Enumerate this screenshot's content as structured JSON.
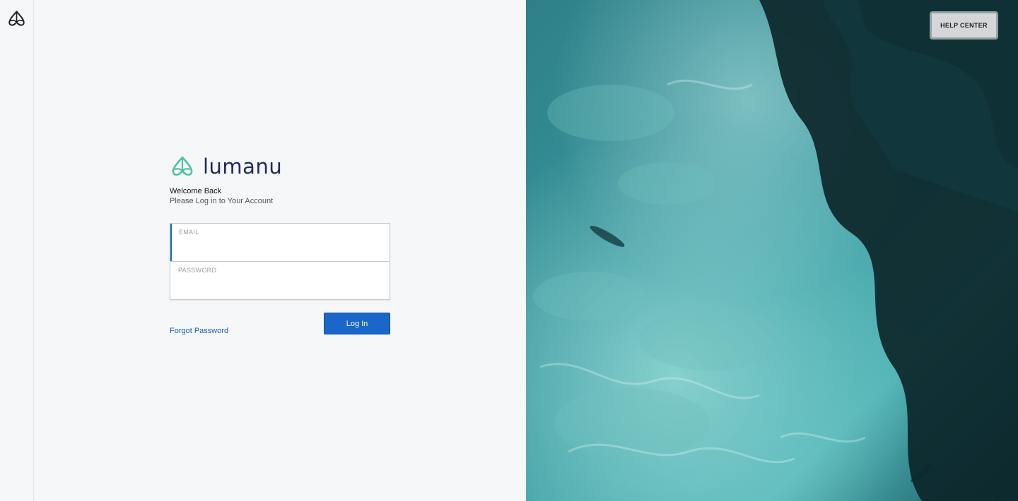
{
  "brand": {
    "name": "lumanu",
    "logo_icon": "lumanu-moth-icon",
    "mark_color": "#4cc3a0",
    "name_color": "#1f2a5a"
  },
  "login": {
    "welcome": "Welcome Back",
    "subtitle": "Please Log in to Your Account",
    "email": {
      "label": "EMAIL",
      "value": ""
    },
    "password": {
      "label": "PASSWORD",
      "value": ""
    },
    "forgot_link": "Forgot Password",
    "submit_label": "Log In"
  },
  "hero": {
    "help_label": "HELP CENTER"
  },
  "colors": {
    "accent": "#1a66c9",
    "link": "#1a5fb4",
    "background": "#f6f7f9"
  }
}
